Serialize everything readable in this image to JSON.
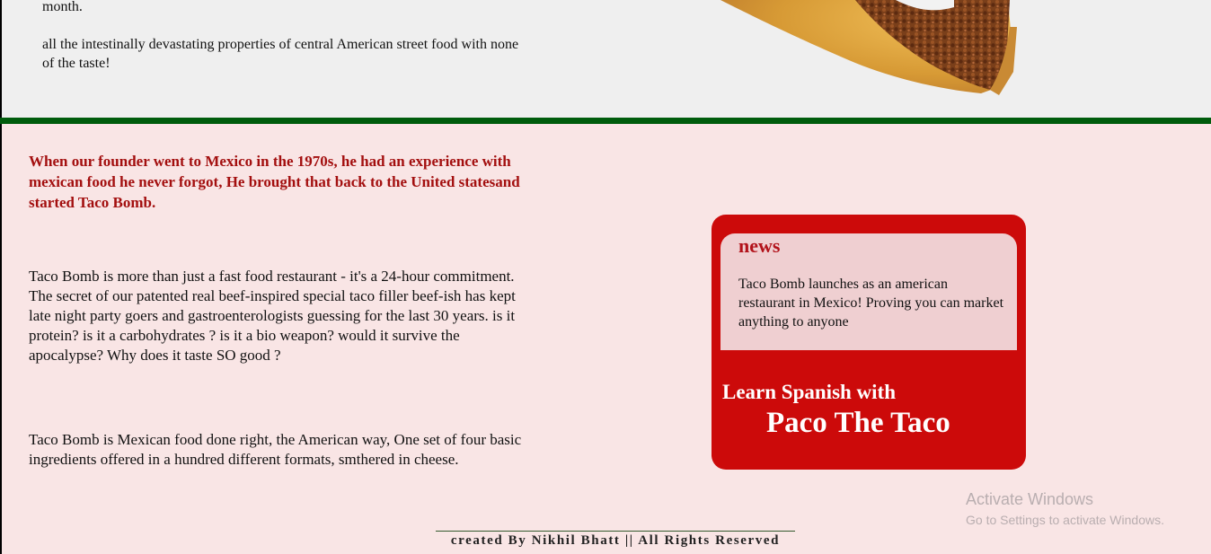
{
  "top": {
    "line1": "month.",
    "line2": "all the intestinally devastating properties of central American street food with none of the taste!"
  },
  "images": {
    "taco": "taco-image"
  },
  "main": {
    "intro": "When our founder went to Mexico in the 1970s, he had an experience with mexican food he never forgot, He brought that back to the United statesand started Taco Bomb.",
    "para1": "Taco Bomb is more than just a fast food restaurant - it's a 24-hour commitment. The secret of our patented real beef-inspired special taco filler beef-ish has kept late night party goers and gastroenterologists guessing for the last 30 years. is it protein? is it a carbohydrates ? is it a bio weapon? would it survive the apocalypse? Why does it taste SO good ?",
    "para2": "Taco Bomb is Mexican food done right, the American way, One set of four basic ingredients offered in a hundred different formats, smthered in cheese."
  },
  "sidebar": {
    "news_heading": "news",
    "news_body": "Taco Bomb launches as an american restaurant in Mexico! Proving you can market anything to anyone",
    "learn_line": "Learn Spanish with",
    "paco_line": "Paco The Taco"
  },
  "overlay": {
    "activate_title": "Activate Windows",
    "activate_sub": "Go to Settings to activate Windows."
  },
  "footer": {
    "text": "created By Nikhil Bhatt || All Rights Reserved"
  },
  "colors": {
    "divider": "#005c0c",
    "intro_text": "#a30f0f",
    "sidebar_box": "#cc0a0a",
    "news_panel": "#efcfd1",
    "page_background": "#f9e5e5"
  }
}
